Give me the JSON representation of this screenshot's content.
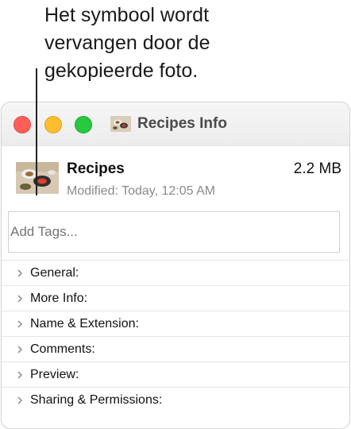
{
  "annotation": {
    "lines": [
      "Het symbool wordt",
      "vervangen door de",
      "gekopieerde foto."
    ]
  },
  "window": {
    "title": "Recipes Info",
    "controls": {
      "close": "close-button",
      "minimize": "minimize-button",
      "maximize": "maximize-button"
    }
  },
  "file": {
    "name": "Recipes",
    "size": "2.2 MB",
    "modified": "Modified: Today, 12:05 AM"
  },
  "tags": {
    "placeholder": "Add Tags..."
  },
  "sections": [
    {
      "label": "General:"
    },
    {
      "label": "More Info:"
    },
    {
      "label": "Name & Extension:"
    },
    {
      "label": "Comments:"
    },
    {
      "label": "Preview:"
    },
    {
      "label": "Sharing & Permissions:"
    }
  ],
  "colors": {
    "close": "#ff5f57",
    "minimize": "#febc2e",
    "maximize": "#28c840"
  }
}
